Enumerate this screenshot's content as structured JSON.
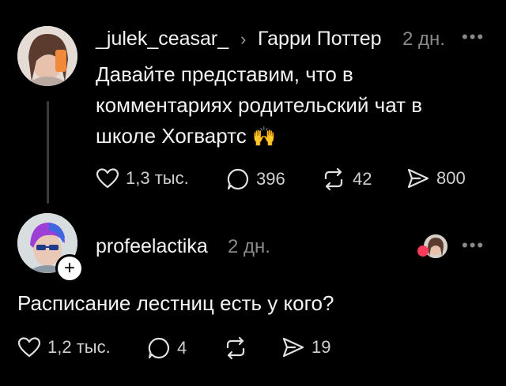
{
  "post": {
    "username": "_julek_ceasar_",
    "reply_to": "Гарри Поттер",
    "time": "2 дн.",
    "text_line1": "Давайте представим, что в",
    "text_line2": "комментариях родительский чат в",
    "text_line3": "школе Хогвартс",
    "emoji": "🙌",
    "likes": "1,3 тыс.",
    "comments": "396",
    "reposts": "42",
    "shares": "800"
  },
  "reply": {
    "username": "profeelactika",
    "time": "2 дн.",
    "text": "Расписание лестниц есть у кого?",
    "likes": "1,2 тыс.",
    "comments": "4",
    "shares": "19"
  },
  "icons": {
    "more": "more-icon",
    "heart": "heart-icon",
    "comment": "comment-icon",
    "repost": "repost-icon",
    "share": "share-icon",
    "plus": "plus-icon",
    "chevron": "chevron-right-icon"
  },
  "colors": {
    "background": "#000000",
    "text": "#f3f3f3",
    "muted": "#8a8a8a",
    "like_badge": "#ff3b5c"
  }
}
